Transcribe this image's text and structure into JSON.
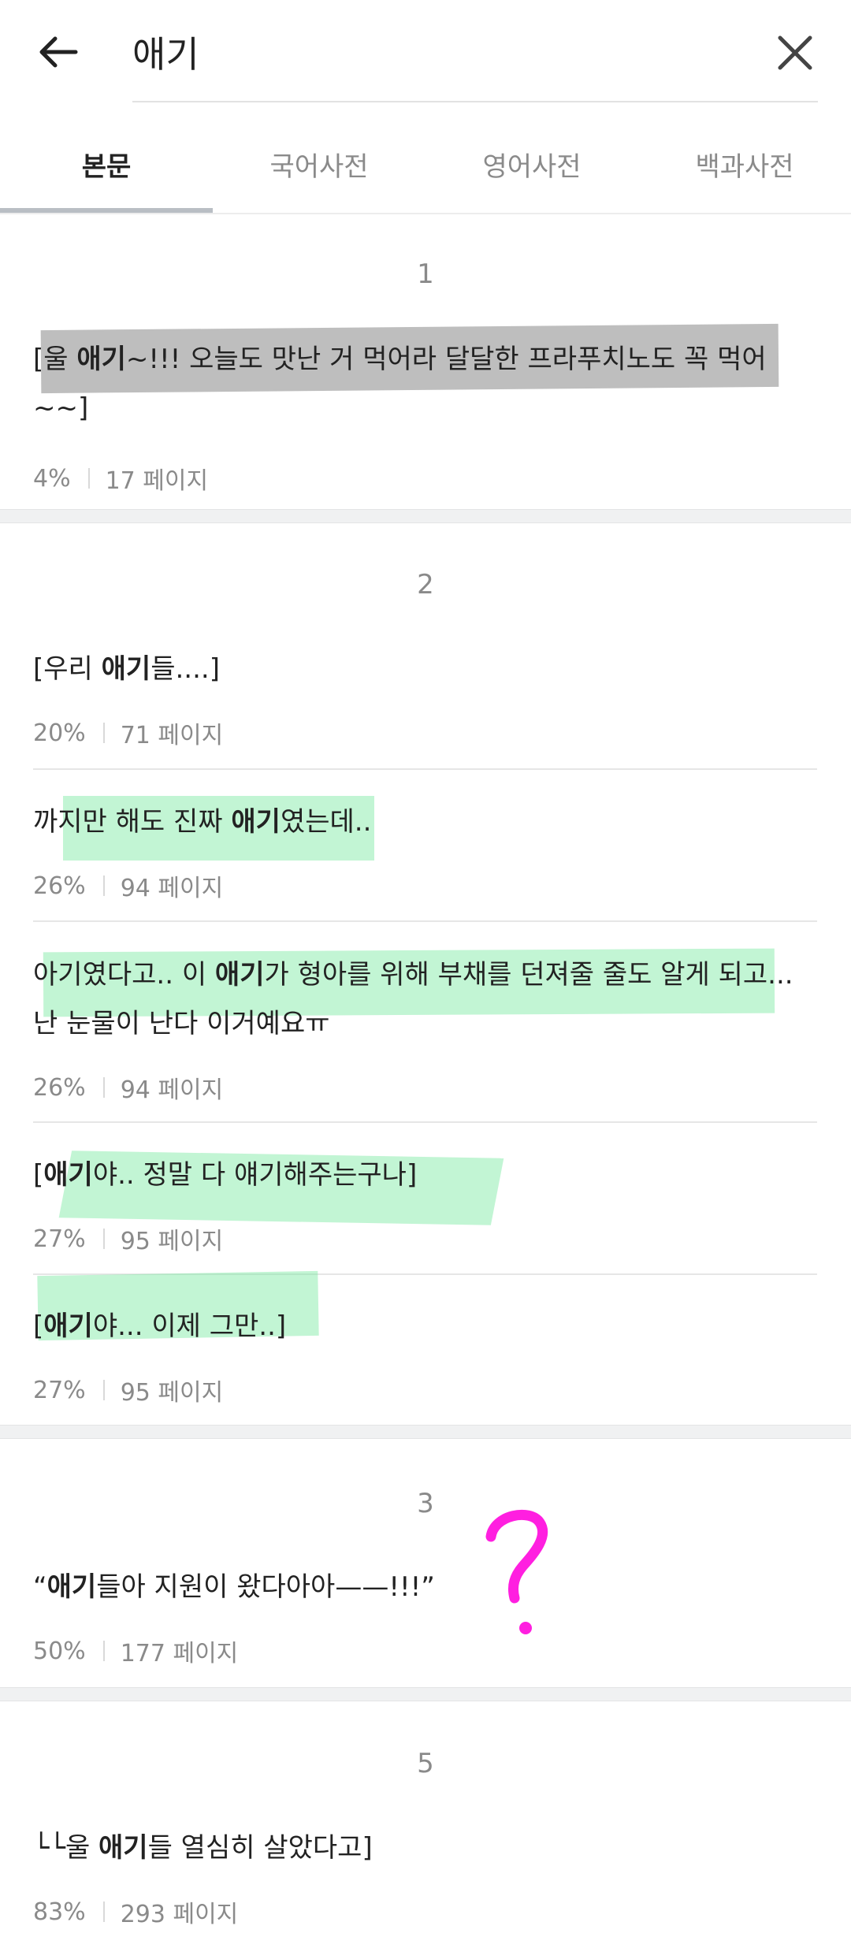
{
  "search": {
    "query": "애기"
  },
  "tabs": [
    {
      "label": "본문",
      "active": true
    },
    {
      "label": "국어사전",
      "active": false
    },
    {
      "label": "영어사전",
      "active": false
    },
    {
      "label": "백과사전",
      "active": false
    }
  ],
  "groups": [
    {
      "number": "1",
      "items": [
        {
          "pre": "[울 ",
          "match": "애기",
          "post": "~!!! 오늘도 맛난 거 먹어라 달달한 프라푸치노도 꼭 먹어~~]",
          "percent": "4%",
          "page": "17 페이지"
        }
      ]
    },
    {
      "number": "2",
      "items": [
        {
          "pre": "[우리 ",
          "match": "애기",
          "post": "들....]",
          "percent": "20%",
          "page": "71 페이지"
        },
        {
          "pre": "까지만 해도 진짜 ",
          "match": "애기",
          "post": "였는데..",
          "percent": "26%",
          "page": "94 페이지"
        },
        {
          "pre": "아기였다고.. 이 ",
          "match": "애기",
          "post": "가 형아를 위해 부채를 던져줄 줄도 알게 되고... 난 눈물이 난다 이거예요ㅠ",
          "percent": "26%",
          "page": "94 페이지"
        },
        {
          "pre": "[",
          "match": "애기",
          "post": "야.. 정말 다 얘기해주는구나]",
          "percent": "27%",
          "page": "95 페이지"
        },
        {
          "pre": "[",
          "match": "애기",
          "post": "야... 이제 그만..]",
          "percent": "27%",
          "page": "95 페이지"
        }
      ]
    },
    {
      "number": "3",
      "items": [
        {
          "pre": "“",
          "match": "애기",
          "post": "들아 지원이 왔다아아——!!!”",
          "percent": "50%",
          "page": "177 페이지"
        }
      ]
    },
    {
      "number": "5",
      "items": [
        {
          "pre": "└└울 ",
          "match": "애기",
          "post": "들 열심히 살았다고]",
          "percent": "83%",
          "page": "293 페이지"
        }
      ]
    }
  ],
  "annotation": {
    "mark": "?",
    "color": "#ff1fe0"
  },
  "colors": {
    "highlight_gray": "#9a9a9a",
    "highlight_green": "#8ff0b0",
    "accent_question": "#ff1fe0"
  }
}
